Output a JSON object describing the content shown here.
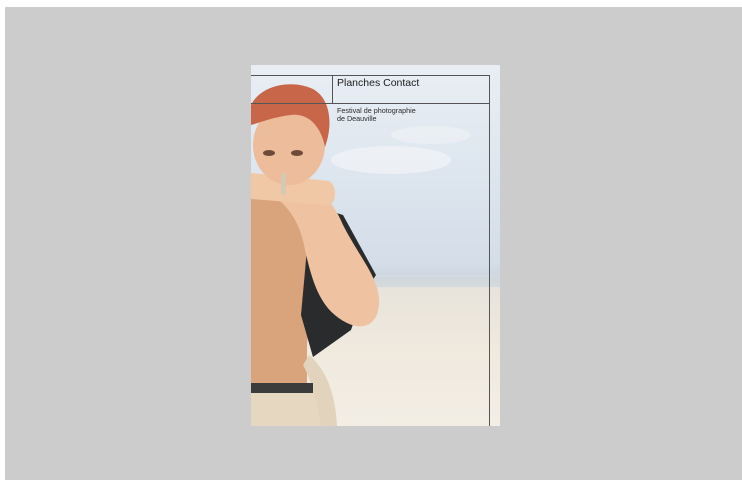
{
  "poster": {
    "title": "Planches Contact",
    "subtitle_line1": "Festival de photographie",
    "subtitle_line2": "de Deauville"
  },
  "colors": {
    "background": "#cccccc",
    "sky": "#dde6ef",
    "sand": "#efe9de",
    "hair": "#c8664a",
    "skin": "#e8b592"
  }
}
